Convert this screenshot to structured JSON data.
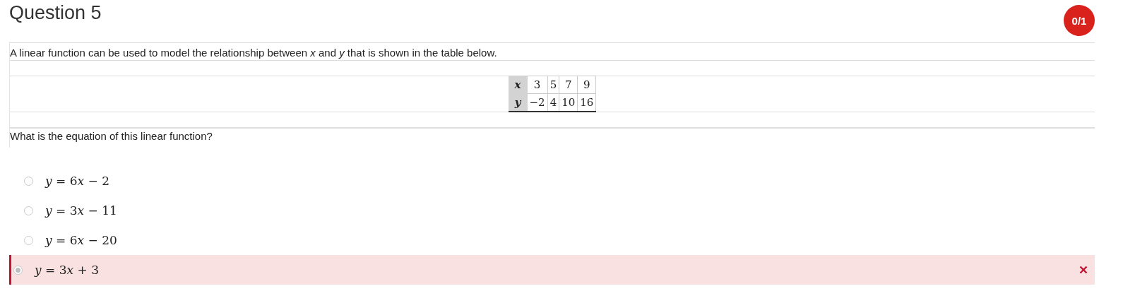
{
  "title": "Question 5",
  "score": "0/1",
  "prompt": "A linear function can be used to model the relationship between *x* and *y* that is shown in the table below.",
  "table": {
    "rows": [
      {
        "label": "x",
        "values": [
          "3",
          "5",
          "7",
          "9"
        ]
      },
      {
        "label": "y",
        "values": [
          "−2",
          "4",
          "10",
          "16"
        ]
      }
    ]
  },
  "question": "What is the equation of this linear function?",
  "choices": [
    {
      "label": "y = 6x − 2",
      "selected": false,
      "kind": "plain"
    },
    {
      "label": "y = 3x − 11",
      "selected": false,
      "kind": "plain"
    },
    {
      "label": "y = 6x − 20",
      "selected": false,
      "kind": "plain"
    },
    {
      "label": "y = 3x + 3",
      "selected": true,
      "kind": "incorrect"
    }
  ]
}
